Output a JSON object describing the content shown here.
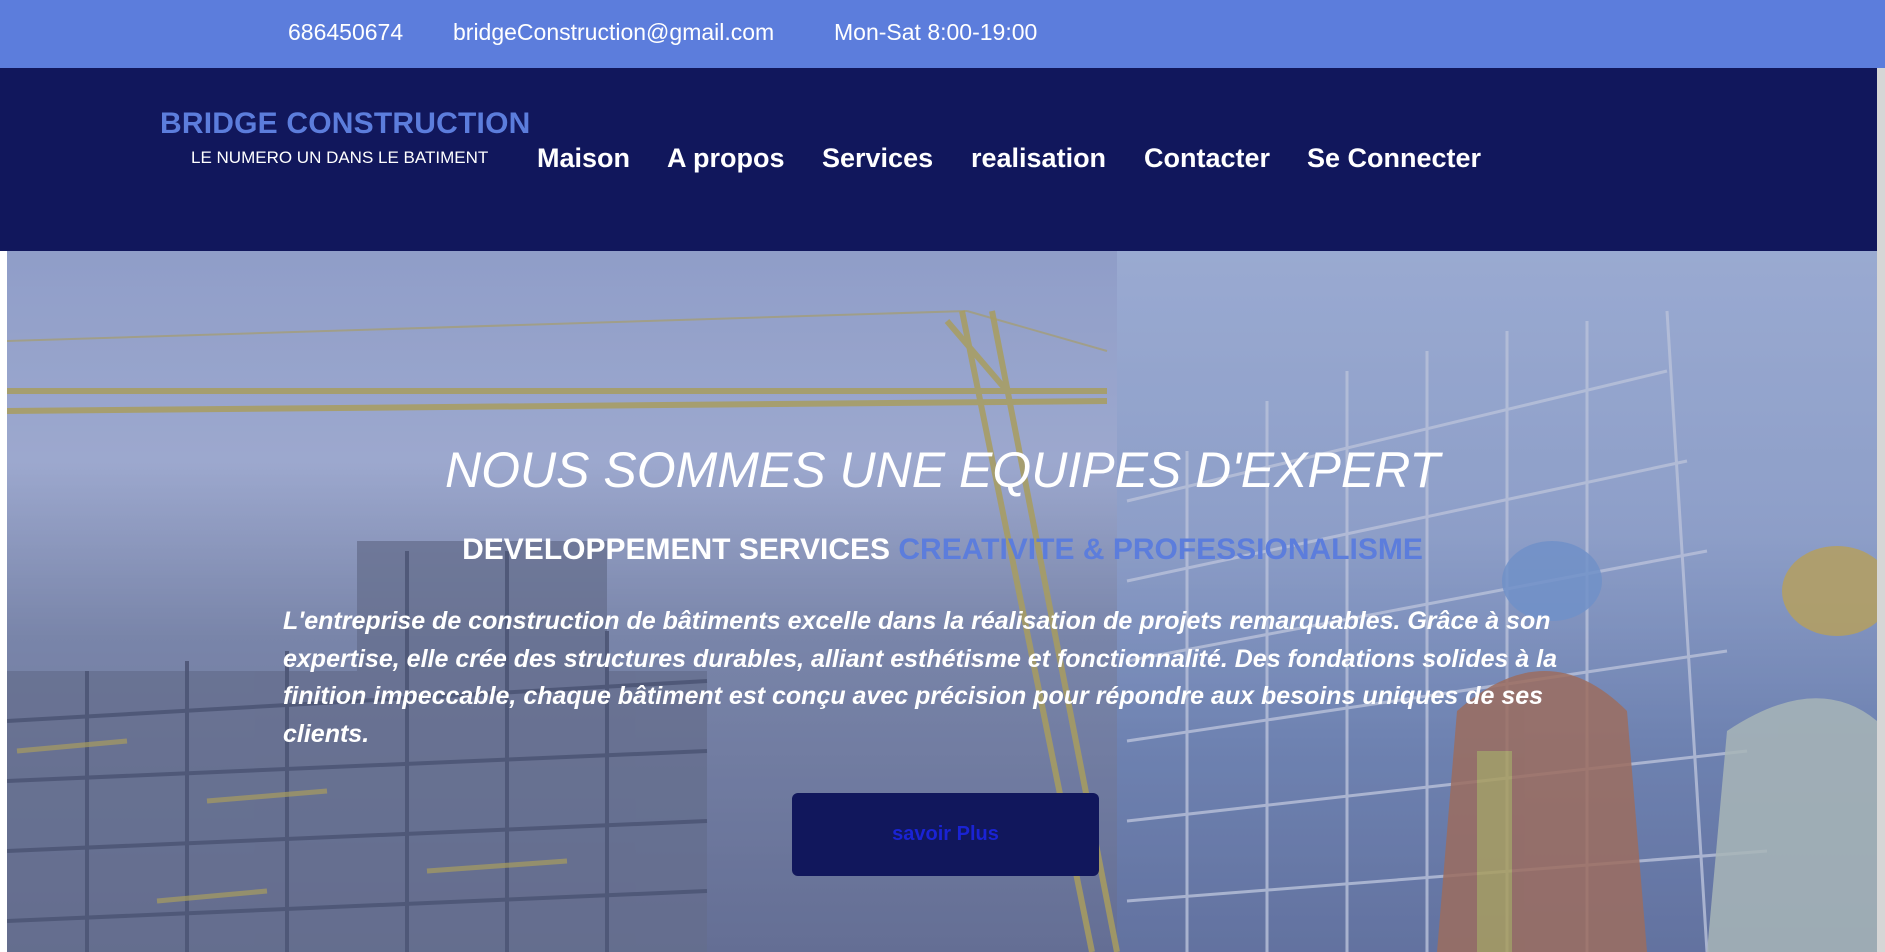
{
  "topbar": {
    "phone": "686450674",
    "email": "bridgeConstruction@gmail.com",
    "hours": "Mon-Sat 8:00-19:00"
  },
  "brand": {
    "name": "BRIDGE CONSTRUCTION",
    "tagline": "LE NUMERO UN DANS LE BATIMENT"
  },
  "nav": {
    "items": [
      {
        "label": "Maison"
      },
      {
        "label": "A propos"
      },
      {
        "label": "Services"
      },
      {
        "label": "realisation"
      },
      {
        "label": "Contacter"
      },
      {
        "label": "Se Connecter"
      }
    ]
  },
  "hero": {
    "title": "NOUS SOMMES UNE EQUIPES D'EXPERT",
    "subtitle_main": "DEVELOPPEMENT SERVICES",
    "subtitle_accent": "CREATIVITE & PROFESSIONALISME",
    "description": "L'entreprise de construction de bâtiments excelle dans la réalisation de projets remarquables. Grâce à son expertise, elle crée des structures durables, alliant esthétisme et fonctionnalité. Des fondations solides à la finition impeccable, chaque bâtiment est conçu avec précision pour répondre aux besoins uniques de ses clients.",
    "button_label": "savoir Plus"
  },
  "colors": {
    "topbar_bg": "#5c7ddc",
    "header_bg": "#11175c",
    "accent": "#5c7ddc",
    "button_text": "#1a23d4"
  }
}
